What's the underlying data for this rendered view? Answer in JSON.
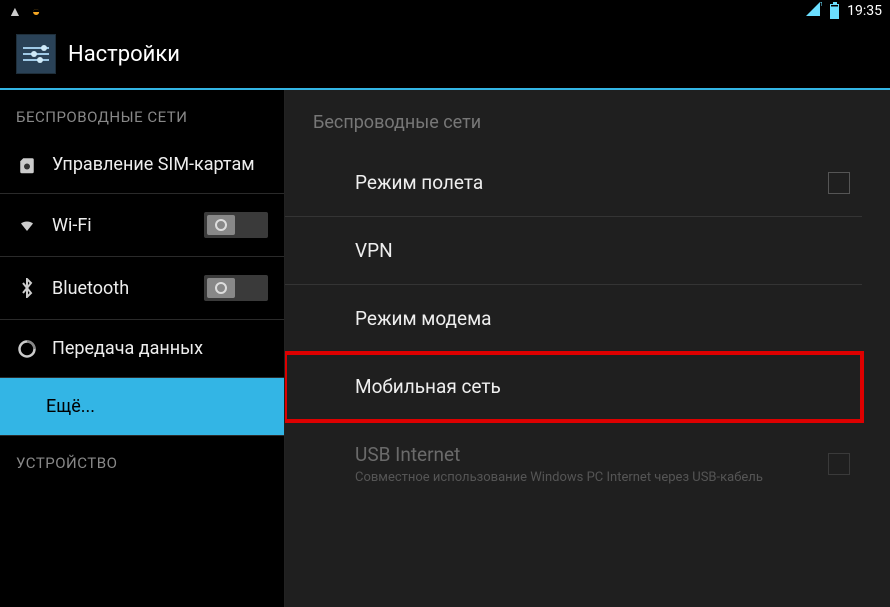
{
  "statusbar": {
    "time": "19:35"
  },
  "header": {
    "title": "Настройки"
  },
  "sidebar": {
    "sections": [
      {
        "name": "wireless",
        "title": "БЕСПРОВОДНЫЕ СЕТИ",
        "items": {
          "sim": "Управление SIM-картам",
          "wifi": "Wi-Fi",
          "bluetooth": "Bluetooth",
          "data": "Передача данных",
          "more": "Ещё..."
        }
      },
      {
        "name": "device",
        "title": "УСТРОЙСТВО"
      }
    ]
  },
  "content": {
    "header": "Беспроводные сети",
    "items": {
      "airplane": {
        "label": "Режим полета"
      },
      "vpn": {
        "label": "VPN"
      },
      "tethering": {
        "label": "Режим модема"
      },
      "mobile": {
        "label": "Мобильная сеть"
      },
      "usb": {
        "label": "USB Internet",
        "desc": "Совместное использование Windows PC Internet через USB-кабель"
      }
    }
  }
}
